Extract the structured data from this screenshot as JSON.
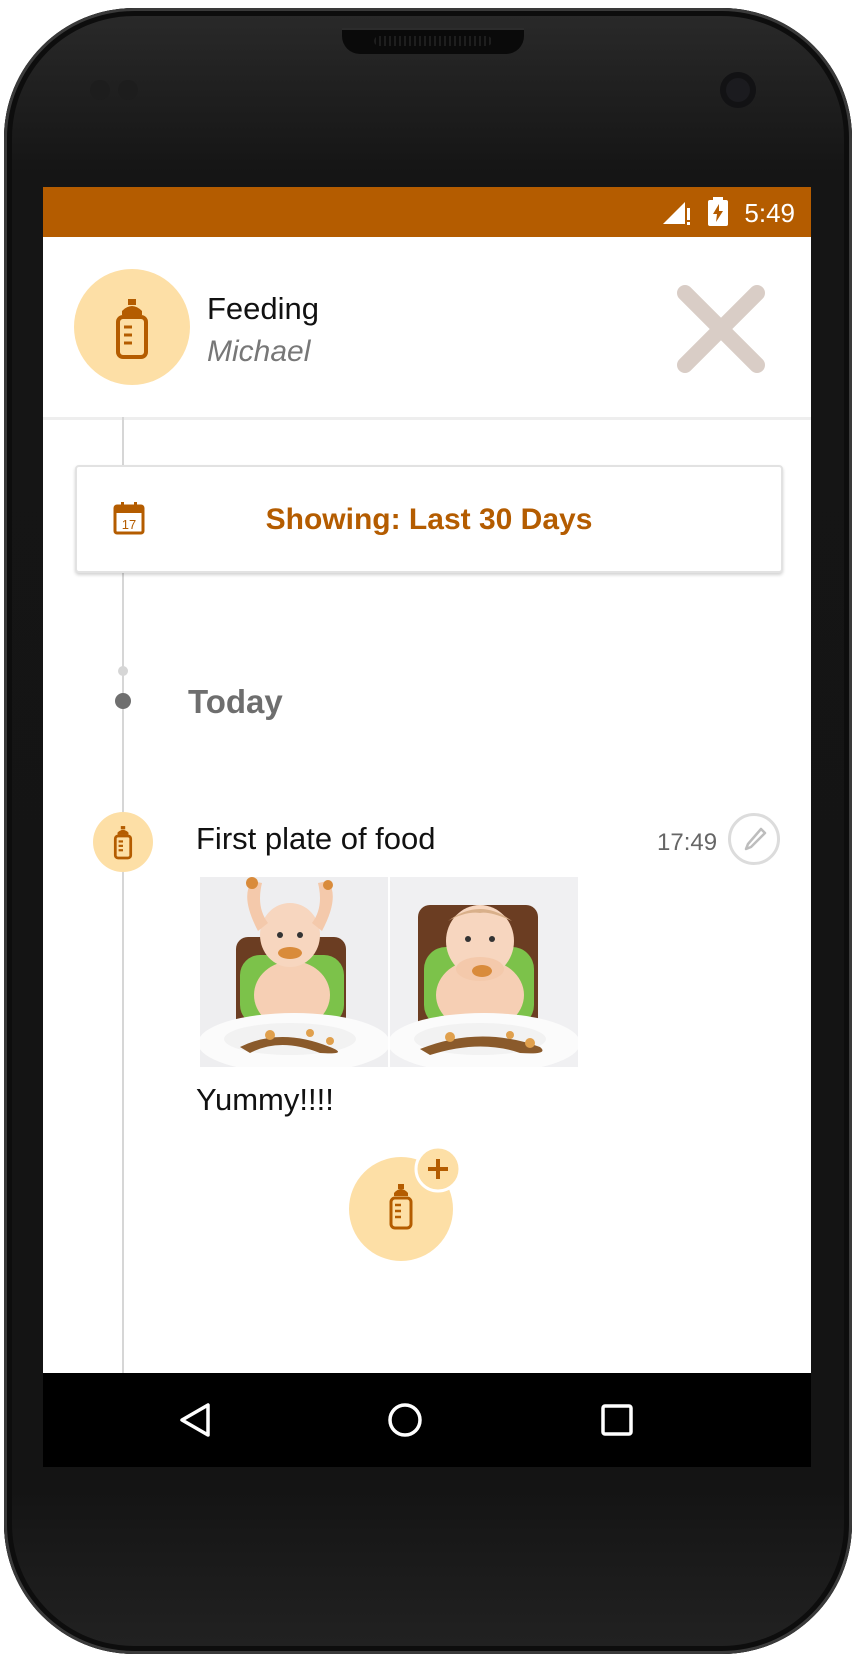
{
  "status_bar": {
    "time": "5:49"
  },
  "header": {
    "title": "Feeding",
    "subtitle": "Michael",
    "avatar_icon": "baby-bottle-icon",
    "close_icon": "close-icon"
  },
  "filter": {
    "label": "Showing: Last 30 Days",
    "icon": "calendar-icon",
    "calendar_day": "17"
  },
  "timeline": {
    "day_label": "Today",
    "entries": [
      {
        "title": "First plate of food",
        "time": "17:49",
        "note": "Yummy!!!!",
        "icon": "baby-bottle-icon",
        "photos": [
          "baby-photo-arms-up",
          "baby-photo-eating"
        ]
      }
    ]
  },
  "fab": {
    "icon": "add-feeding-icon"
  },
  "navigation": {
    "back_icon": "back-triangle-icon",
    "home_icon": "home-circle-icon",
    "recents_icon": "recents-square-icon"
  },
  "colors": {
    "accent": "#b45c00",
    "avatar_bg": "#fddfa6",
    "close_x": "#d9cdc6"
  }
}
